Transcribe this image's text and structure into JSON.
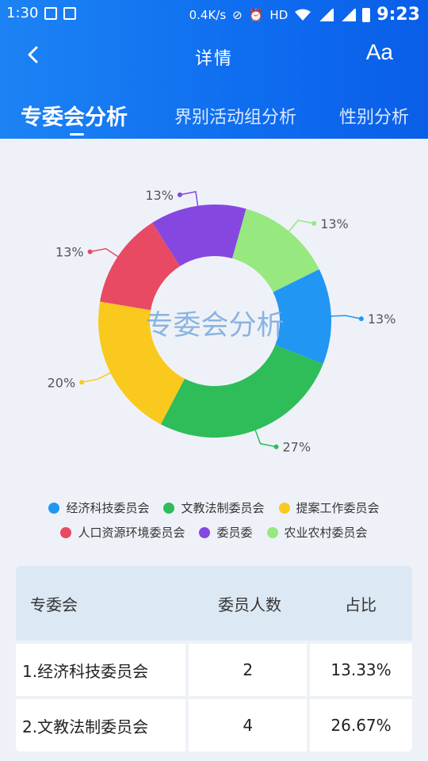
{
  "status_bar": {
    "left_text": "1:30",
    "speed": "0.4K/s",
    "time": "9:23"
  },
  "nav": {
    "title": "详情",
    "font_label": "Aa"
  },
  "tabs": [
    {
      "label": "专委会分析",
      "active": true
    },
    {
      "label": "界别活动组分析",
      "active": false
    },
    {
      "label": "性别分析",
      "active": false
    }
  ],
  "chart_data": {
    "type": "pie",
    "title": "专委会分析",
    "labels": [
      "经济科技委员会",
      "文教法制委员会",
      "提案工作委员会",
      "人口资源环境委员会",
      "委员委",
      "农业农村委员会"
    ],
    "values": [
      13.33,
      26.67,
      20,
      13.33,
      13.33,
      13.33
    ],
    "label_texts": [
      "13%",
      "27%",
      "20%",
      "13%",
      "13%",
      "13%"
    ],
    "colors": [
      "#2196f3",
      "#2ebd59",
      "#f9c91d",
      "#e84a64",
      "#8547e0",
      "#97e87f"
    ],
    "legend_position": "bottom"
  },
  "table": {
    "headers": [
      "专委会",
      "委员人数",
      "占比"
    ],
    "rows": [
      {
        "name": "1.经济科技委员会",
        "count": "2",
        "pct": "13.33%"
      },
      {
        "name": "2.文教法制委员会",
        "count": "4",
        "pct": "26.67%"
      }
    ]
  }
}
